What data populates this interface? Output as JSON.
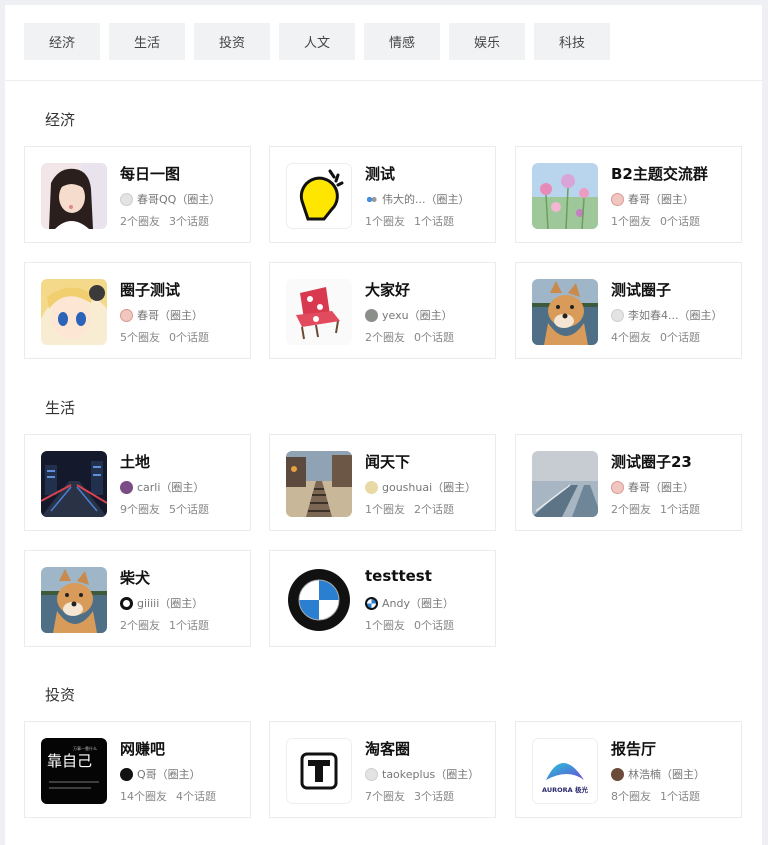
{
  "tabs": [
    "经济",
    "生活",
    "投资",
    "人文",
    "情感",
    "娱乐",
    "科技"
  ],
  "sections": [
    {
      "title": "经济",
      "cards": [
        {
          "name": "每日一图",
          "owner": "春哥QQ",
          "owner_role": "（圈主）",
          "members": "2个圈友",
          "topics": "3个话题",
          "thumb": "girl-photo",
          "avatar": "default-avatar"
        },
        {
          "name": "测试",
          "owner": "伟大的...",
          "owner_role": "（圈主）",
          "members": "1个圈友",
          "topics": "1个话题",
          "thumb": "lightbulb",
          "avatar": "dots-avatar"
        },
        {
          "name": "B2主题交流群",
          "owner": "春哥",
          "owner_role": "（圈主）",
          "members": "1个圈友",
          "topics": "0个话题",
          "thumb": "flowers-photo",
          "avatar": "pink-avatar"
        },
        {
          "name": "圈子测试",
          "owner": "春哥",
          "owner_role": "（圈主）",
          "members": "5个圈友",
          "topics": "0个话题",
          "thumb": "anime-girl",
          "avatar": "pink-avatar"
        },
        {
          "name": "大家好",
          "owner": "yexu",
          "owner_role": "（圈主）",
          "members": "2个圈友",
          "topics": "0个话题",
          "thumb": "red-chair",
          "avatar": "grey-avatar"
        },
        {
          "name": "测试圈子",
          "owner": "李如春4...",
          "owner_role": "（圈主）",
          "members": "4个圈友",
          "topics": "0个话题",
          "thumb": "dog-lake",
          "avatar": "default-avatar"
        }
      ]
    },
    {
      "title": "生活",
      "cards": [
        {
          "name": "土地",
          "owner": "carli",
          "owner_role": "（圈主）",
          "members": "9个圈友",
          "topics": "5个话题",
          "thumb": "city-night",
          "avatar": "purple-avatar"
        },
        {
          "name": "闻天下",
          "owner": "goushuai",
          "owner_role": "（圈主）",
          "members": "1个圈友",
          "topics": "2个话题",
          "thumb": "railway",
          "avatar": "figure-avatar"
        },
        {
          "name": "测试圈子23",
          "owner": "春哥",
          "owner_role": "（圈主）",
          "members": "2个圈友",
          "topics": "1个话题",
          "thumb": "foggy-road",
          "avatar": "pink-avatar"
        },
        {
          "name": "柴犬",
          "owner": "giiiii",
          "owner_role": "（圈主）",
          "members": "2个圈友",
          "topics": "1个话题",
          "thumb": "dog-lake",
          "avatar": "swirl-avatar"
        },
        {
          "name": "testtest",
          "owner": "Andy",
          "owner_role": "（圈主）",
          "members": "1个圈友",
          "topics": "0个话题",
          "thumb": "bmw-logo",
          "avatar": "bmw-avatar"
        }
      ]
    },
    {
      "title": "投资",
      "cards": [
        {
          "name": "网赚吧",
          "owner": "Q哥",
          "owner_role": "（圈主）",
          "members": "14个圈友",
          "topics": "4个话题",
          "thumb": "black-poster",
          "avatar": "black-avatar"
        },
        {
          "name": "淘客圈",
          "owner": "taokeplus",
          "owner_role": "（圈主）",
          "members": "7个圈友",
          "topics": "3个话题",
          "thumb": "t-logo",
          "avatar": "default-avatar"
        },
        {
          "name": "报告厅",
          "owner": "林浩楠",
          "owner_role": "（圈主）",
          "members": "8个圈友",
          "topics": "1个话题",
          "thumb": "aurora-logo",
          "avatar": "man-avatar"
        }
      ]
    }
  ],
  "thumb_texts": {
    "black_poster_big": "靠自己",
    "black_poster_small": "万事一靠什么",
    "aurora": "AURORA 极光"
  },
  "colors": {
    "page_bg": "#eef0f4",
    "tab_bg": "#f1f2f4",
    "card_border": "#ebebeb"
  }
}
